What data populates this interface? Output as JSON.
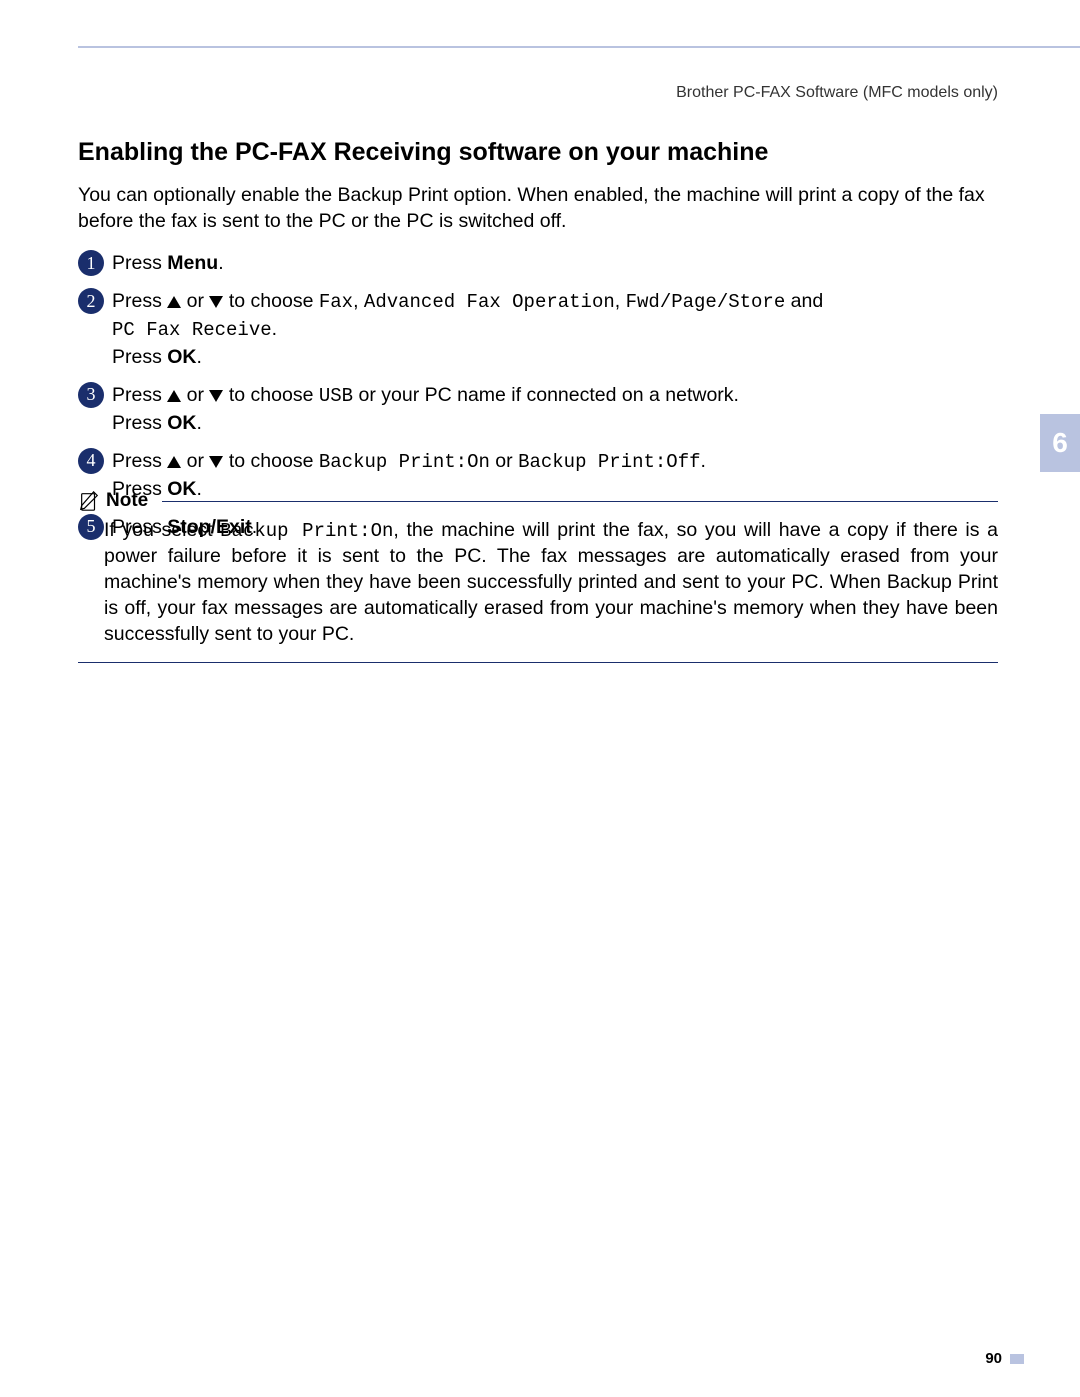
{
  "header": {
    "running_title": "Brother PC-FAX Software (MFC models only)"
  },
  "section": {
    "heading": "Enabling the PC-FAX Receiving software on your machine",
    "intro": "You can optionally enable the Backup Print option. When enabled, the machine will print a copy of the fax before the fax is sent to the PC or the PC is switched off."
  },
  "steps": {
    "s1": {
      "num": "1",
      "press": "Press ",
      "menu": "Menu",
      "dot": "."
    },
    "s2": {
      "num": "2",
      "press": "Press ",
      "or": " or ",
      "choose": " to choose ",
      "opt1": "Fax",
      "c1": ", ",
      "opt2": "Advanced Fax Operation",
      "c2": ", ",
      "opt3": "Fwd/Page/Store",
      "and": " and ",
      "opt4": "PC Fax Receive",
      "dot": ".",
      "press_ok_pre": "Press ",
      "ok": "OK",
      "press_ok_post": "."
    },
    "s3": {
      "num": "3",
      "press": "Press ",
      "or": " or ",
      "choose": " to choose ",
      "usb": "USB",
      "rest": " or your PC name if connected on a network.",
      "press_ok_pre": "Press ",
      "ok": "OK",
      "press_ok_post": "."
    },
    "s4": {
      "num": "4",
      "press": "Press ",
      "or": " or ",
      "choose": " to choose ",
      "opt_on": "Backup Print:On",
      "or2": " or ",
      "opt_off": "Backup Print:Off",
      "dot": ".",
      "press_ok_pre": "Press ",
      "ok": "OK",
      "press_ok_post": "."
    },
    "s5": {
      "num": "5",
      "press": "Press ",
      "stop": "Stop/Exit",
      "dot": "."
    }
  },
  "note": {
    "label": "Note",
    "pre": "If you select ",
    "mono": "Backup Print:On",
    "post": ", the machine will print the fax, so you will have a copy if there is a power failure before it is sent to the PC. The fax messages are automatically erased from your machine's memory when they have been successfully printed and sent to your PC. When Backup Print is off, your fax messages are automatically erased from your machine's memory when they have been successfully sent to your PC."
  },
  "chapter_tab": "6",
  "page_number": "90"
}
